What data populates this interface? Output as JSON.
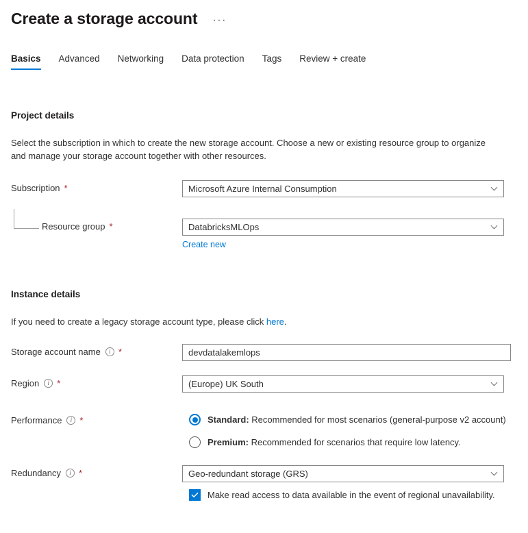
{
  "header": {
    "title": "Create a storage account",
    "more_menu": "···"
  },
  "tabs": [
    {
      "label": "Basics",
      "active": true
    },
    {
      "label": "Advanced",
      "active": false
    },
    {
      "label": "Networking",
      "active": false
    },
    {
      "label": "Data protection",
      "active": false
    },
    {
      "label": "Tags",
      "active": false
    },
    {
      "label": "Review + create",
      "active": false
    }
  ],
  "project_details": {
    "heading": "Project details",
    "description": "Select the subscription in which to create the new storage account. Choose a new or existing resource group to organize and manage your storage account together with other resources.",
    "subscription": {
      "label": "Subscription",
      "required": "*",
      "value": "Microsoft Azure Internal Consumption"
    },
    "resource_group": {
      "label": "Resource group",
      "required": "*",
      "value": "DatabricksMLOps",
      "create_new_link": "Create new"
    }
  },
  "instance_details": {
    "heading": "Instance details",
    "description_before_link": "If you need to create a legacy storage account type, please click ",
    "description_link": "here",
    "description_after_link": ".",
    "storage_account_name": {
      "label": "Storage account name",
      "required": "*",
      "value": "devdatalakemlops",
      "placeholder": ""
    },
    "region": {
      "label": "Region",
      "required": "*",
      "value": "(Europe) UK South"
    },
    "performance": {
      "label": "Performance",
      "required": "*",
      "options": [
        {
          "name": "Standard:",
          "description": " Recommended for most scenarios (general-purpose v2 account)",
          "selected": true
        },
        {
          "name": "Premium:",
          "description": " Recommended for scenarios that require low latency.",
          "selected": false
        }
      ]
    },
    "redundancy": {
      "label": "Redundancy",
      "required": "*",
      "value": "Geo-redundant storage (GRS)",
      "checkbox_label": "Make read access to data available in the event of regional unavailability.",
      "checkbox_checked": true
    }
  },
  "colors": {
    "accent": "#0078d4",
    "required_asterisk": "#a4262c",
    "link": "#0078d4",
    "border": "#8a8886",
    "text": "#323130",
    "background": "#ffffff"
  },
  "icons": {
    "info": "ℹ",
    "chevron_down": "chevron-down-icon",
    "check": "check-icon"
  }
}
